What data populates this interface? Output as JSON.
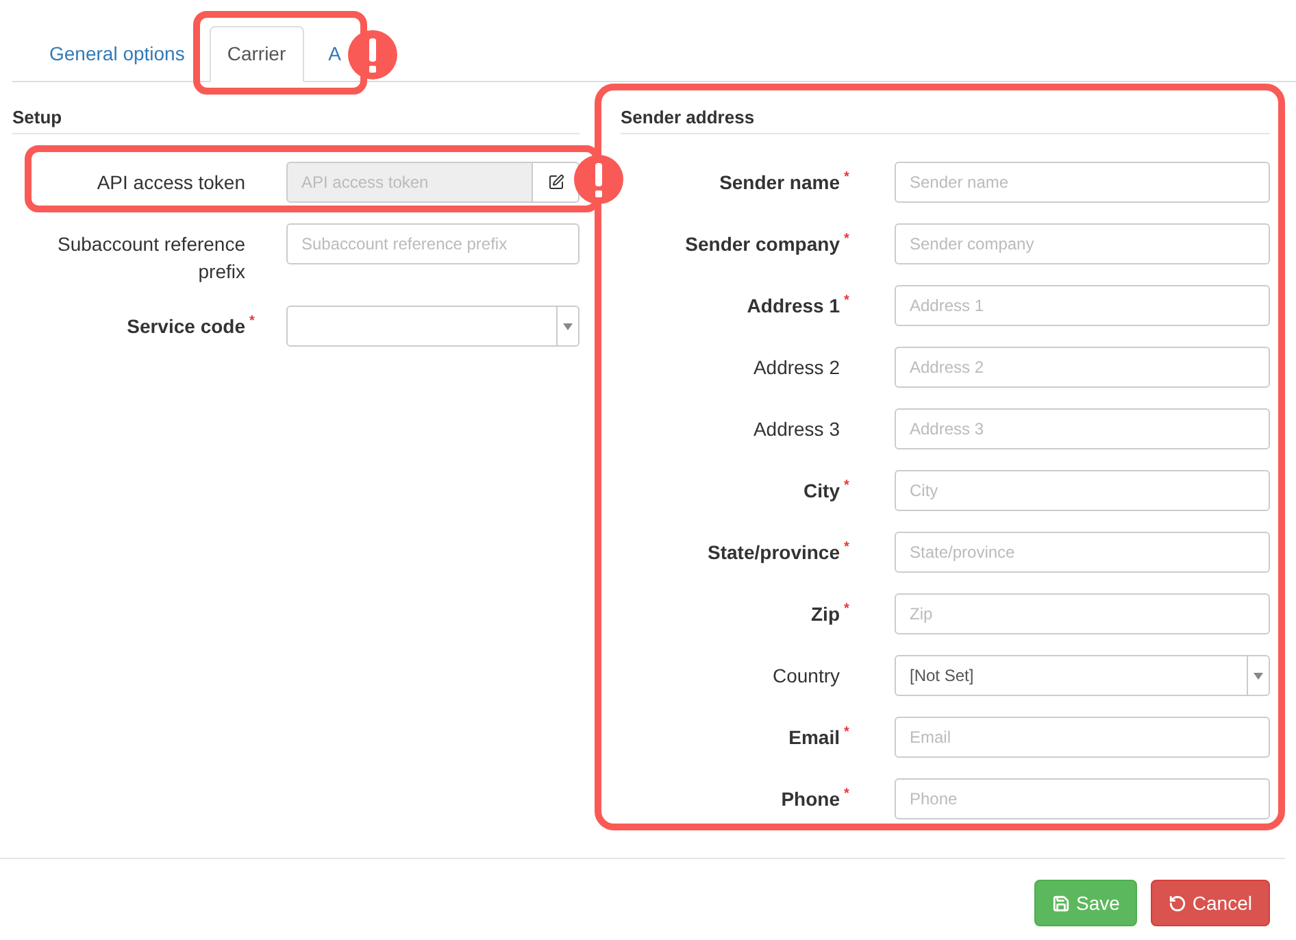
{
  "tabs": [
    {
      "label": "General options",
      "selected": false
    },
    {
      "label": "Carrier",
      "selected": true
    },
    {
      "label": "A",
      "selected": false
    }
  ],
  "setup": {
    "title": "Setup",
    "fields": [
      {
        "kind": "token",
        "label": "API access token",
        "placeholder": "API access token",
        "disabled": true
      },
      {
        "kind": "text",
        "label": "Subaccount reference prefix",
        "placeholder": "Subaccount reference prefix"
      },
      {
        "kind": "select",
        "label": "Service code",
        "mark": "*"
      }
    ]
  },
  "sender": {
    "title": "Sender address",
    "fields": [
      {
        "kind": "text",
        "label": "Sender name",
        "mark": "*",
        "placeholder": "Sender name"
      },
      {
        "kind": "text",
        "label": "Sender company",
        "mark": "*",
        "placeholder": "Sender company"
      },
      {
        "kind": "text",
        "label": "Address 1",
        "mark": "*",
        "placeholder": "Address 1"
      },
      {
        "kind": "text",
        "label": "Address 2",
        "placeholder": "Address 2"
      },
      {
        "kind": "text",
        "label": "Address 3",
        "placeholder": "Address 3"
      },
      {
        "kind": "text",
        "label": "City",
        "mark": "*",
        "placeholder": "City"
      },
      {
        "kind": "text",
        "label": "State/province",
        "mark": "*",
        "placeholder": "State/province"
      },
      {
        "kind": "text",
        "label": "Zip",
        "mark": "*",
        "placeholder": "Zip"
      },
      {
        "kind": "select",
        "label": "Country",
        "value": "[Not Set]"
      },
      {
        "kind": "text",
        "label": "Email",
        "mark": "*",
        "placeholder": "Email"
      },
      {
        "kind": "text",
        "label": "Phone",
        "mark": "*",
        "placeholder": "Phone"
      }
    ]
  },
  "buttons": [
    {
      "kind": "save",
      "label": "Save"
    },
    {
      "kind": "cancel",
      "label": "Cancel"
    }
  ]
}
